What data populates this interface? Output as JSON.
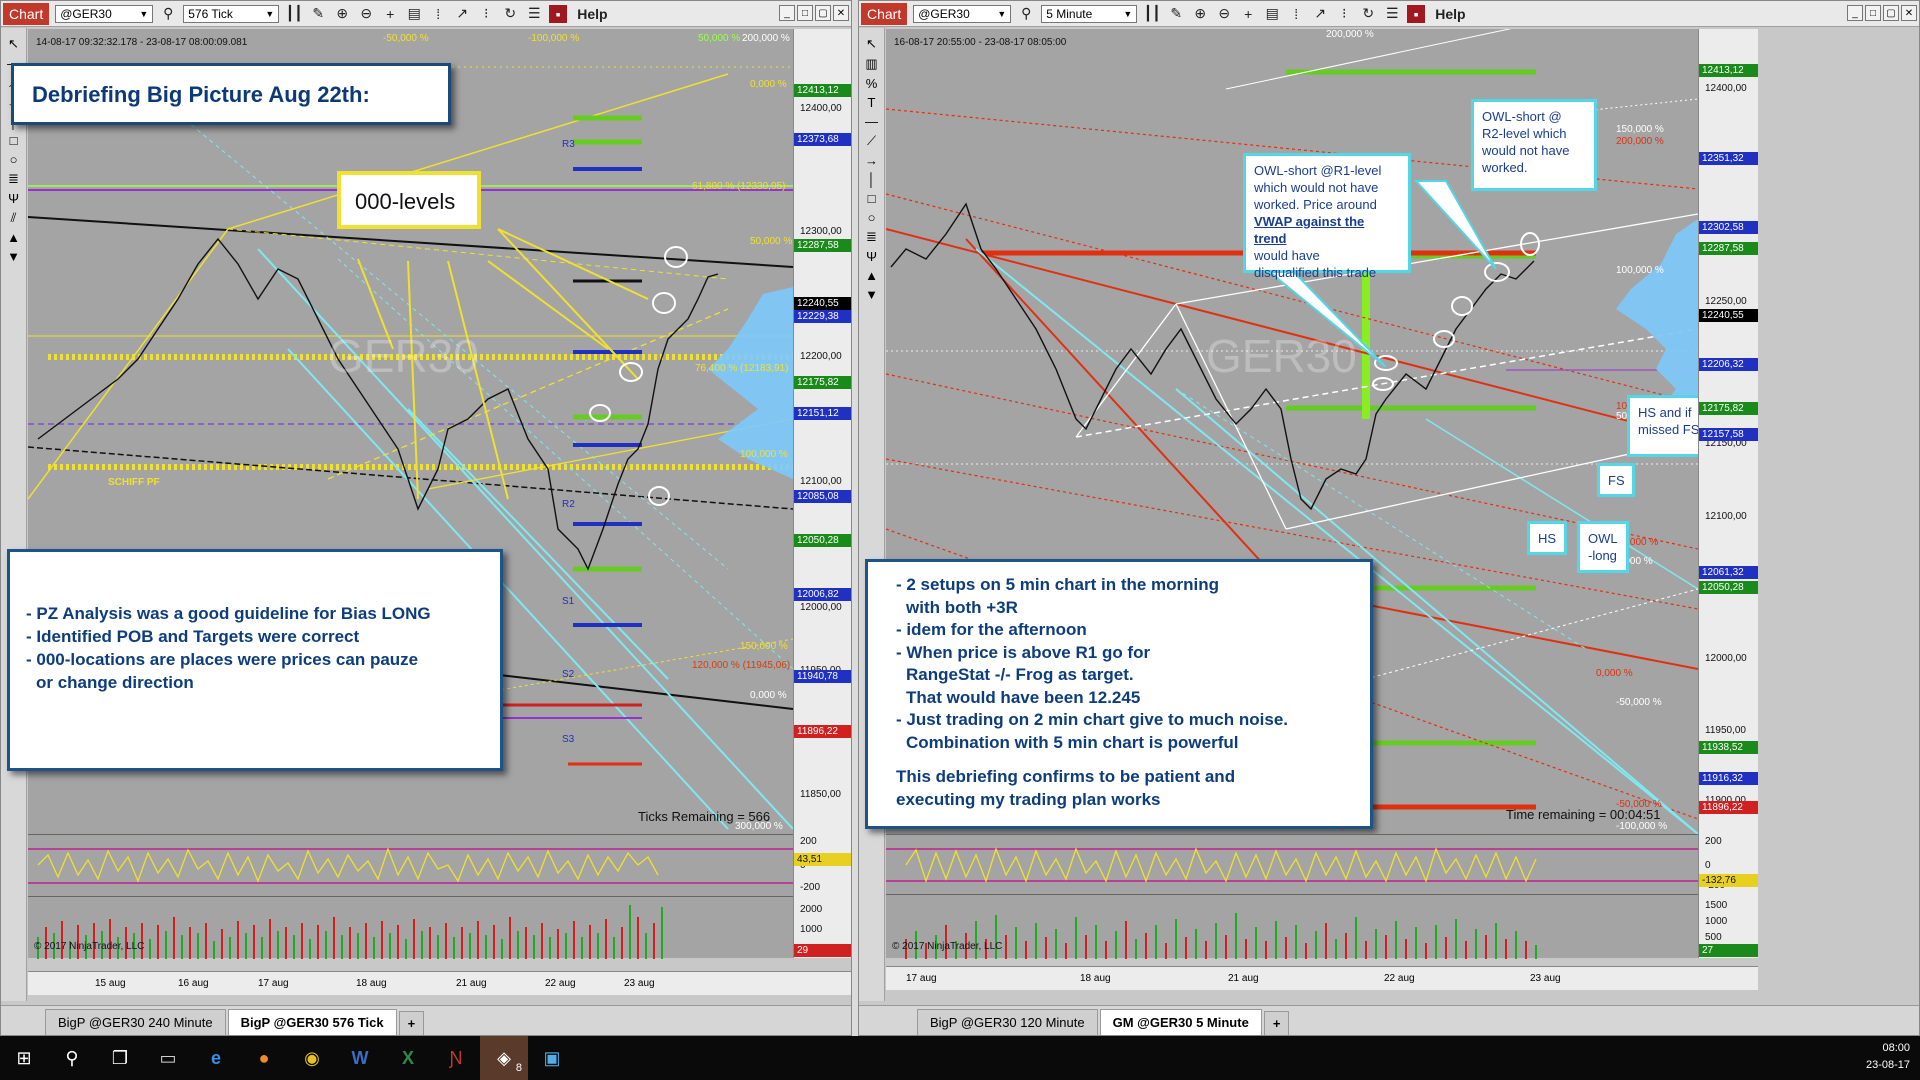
{
  "left": {
    "toolbar": {
      "badge": "Chart",
      "instrument": "@GER30",
      "interval": "576 Tick",
      "help": "Help"
    },
    "range": "14-08-17 09:32:32.178 - 23-08-17 08:00:09.081",
    "title_note": "Debriefing Big Picture Aug 22th:",
    "levels_label": "000-levels",
    "schiff_label": "SCHIFF PF",
    "watermark": "GER30",
    "ticks_remaining": "Ticks Remaining = 566",
    "note_lines": [
      "- PZ Analysis was a good guideline for Bias LONG",
      "- Identified POB and Targets were correct",
      "- 000-locations are places were prices can pauze",
      "  or change direction"
    ],
    "axis_ticks": [
      "12400,00",
      "12300,00",
      "12200,00",
      "12100,00",
      "12000,00",
      "11950,00",
      "11850,00"
    ],
    "axis_labels": [
      {
        "text": "12413,12",
        "color": "#1a8a1a"
      },
      {
        "text": "12373,68",
        "color": "#2030c0"
      },
      {
        "text": "12287,58",
        "color": "#1a8a1a"
      },
      {
        "text": "12240,55",
        "color": "#000000"
      },
      {
        "text": "12229,38",
        "color": "#2030c0"
      },
      {
        "text": "12175,82",
        "color": "#1a8a1a"
      },
      {
        "text": "12151,12",
        "color": "#2030c0"
      },
      {
        "text": "12085,08",
        "color": "#2030c0"
      },
      {
        "text": "12050,28",
        "color": "#1a8a1a"
      },
      {
        "text": "12006,82",
        "color": "#2030c0"
      },
      {
        "text": "11940,78",
        "color": "#2030c0"
      },
      {
        "text": "11896,22",
        "color": "#d02020"
      }
    ],
    "fib_labels": [
      "-50,000 %",
      "-100,000 %",
      "50,000 %",
      "200,000 %",
      "0,000 %",
      "61,800 % (12330,95)",
      "50,000 %",
      "76,400 % (12183,91)",
      "100,000 %",
      "150,000 %",
      "120,000 % (11945,06)",
      "0,000 %",
      "300,000 %"
    ],
    "pivot_labels": [
      "R3",
      "R2",
      "R1",
      "S1",
      "S2",
      "S3"
    ],
    "osc_ticks": [
      "200",
      "0",
      "-200"
    ],
    "osc_value": "43,51",
    "vol_ticks": [
      "2000",
      "1000"
    ],
    "vol_value": "29",
    "copyright": "© 2017 NinjaTrader, LLC",
    "dates": [
      "15 aug",
      "16 aug",
      "17 aug",
      "18 aug",
      "21 aug",
      "22 aug",
      "23 aug"
    ],
    "tabs": [
      "BigP @GER30 240 Minute",
      "BigP @GER30 576 Tick",
      "+"
    ]
  },
  "right": {
    "toolbar": {
      "badge": "Chart",
      "instrument": "@GER30",
      "interval": "5 Minute",
      "help": "Help"
    },
    "range": "16-08-17 20:55:00 - 23-08-17 08:05:00",
    "watermark": "GER30",
    "time_remaining": "Time remaining = 00:04:51",
    "owl_r1": [
      "OWL-short @R1-level",
      "which would not have",
      "worked. Price around"
    ],
    "owl_r1_link": "VWAP against the trend",
    "owl_r1_tail": [
      "would have",
      "disqualified this trade"
    ],
    "owl_r2": [
      "OWL-short @",
      "R2-level which",
      "would not have",
      "worked."
    ],
    "hs_fs": [
      "HS and if",
      "missed FS"
    ],
    "fs": "FS",
    "hs": "HS",
    "owl_long": [
      "OWL",
      "-long"
    ],
    "note_lines": [
      "- 2 setups on 5 min chart in the morning",
      "  with both +3R",
      "- idem for the afternoon",
      "- When price is above R1 go for",
      "  RangeStat -/- Frog as target.",
      "  That would have been 12.245",
      "- Just trading on 2 min chart give to much noise.",
      "  Combination with 5 min chart is powerful",
      "",
      "This debriefing confirms to be patient and",
      "executing my trading plan works"
    ],
    "axis_ticks": [
      "12400,00",
      "12250,00",
      "12150,00",
      "12100,00",
      "12000,00",
      "11950,00",
      "11900,00"
    ],
    "axis_labels": [
      {
        "text": "12413,12",
        "color": "#1a8a1a"
      },
      {
        "text": "12351,32",
        "color": "#2030c0"
      },
      {
        "text": "12302,58",
        "color": "#2030c0"
      },
      {
        "text": "12287,58",
        "color": "#1a8a1a"
      },
      {
        "text": "12240,55",
        "color": "#000000"
      },
      {
        "text": "12206,32",
        "color": "#2030c0"
      },
      {
        "text": "12175,82",
        "color": "#1a8a1a"
      },
      {
        "text": "12157,58",
        "color": "#2030c0"
      },
      {
        "text": "12061,32",
        "color": "#2030c0"
      },
      {
        "text": "12050,28",
        "color": "#1a8a1a"
      },
      {
        "text": "11938,52",
        "color": "#1a8a1a"
      },
      {
        "text": "11916,32",
        "color": "#2030c0"
      },
      {
        "text": "11896,22",
        "color": "#d02020"
      }
    ],
    "fib_labels": [
      "200,000 %",
      "150,000 %",
      "200,000 %",
      "100,000 %",
      "100,000 %",
      "50,000 %",
      "50,000 %",
      "0,000 %",
      "0,000 %",
      "-50,000 %",
      "-50,000 %",
      "-100,000 %",
      "-100,000 %"
    ],
    "osc_ticks": [
      "200",
      "0",
      "-200"
    ],
    "osc_value": "-132,76",
    "vol_ticks": [
      "1500",
      "1000",
      "500"
    ],
    "vol_value": "27",
    "copyright": "© 2017 NinjaTrader, LLC",
    "dates": [
      "17 aug",
      "18 aug",
      "21 aug",
      "22 aug",
      "23 aug"
    ],
    "tabs": [
      "BigP @GER30 120 Minute",
      "GM @GER30 5 Minute",
      "+"
    ]
  },
  "taskbar": {
    "time": "08:00",
    "date": "23-08-17",
    "badge": "8"
  },
  "colors": {
    "plot_bg": "#a4a4a4",
    "note_border": "#1c5487",
    "note_text": "#0d3d7c",
    "callout_cyan": "#55d6e6",
    "level_yellow": "#f0e030",
    "level_green": "#66cc22",
    "level_blue": "#2030c0",
    "level_red": "#e03010"
  }
}
